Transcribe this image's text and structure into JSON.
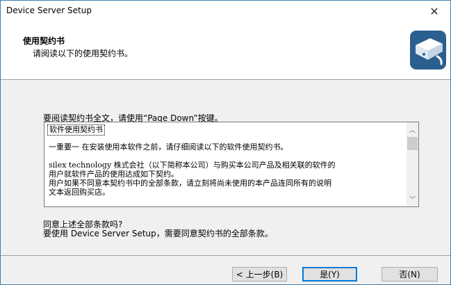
{
  "window": {
    "title": "Device Server Setup"
  },
  "header": {
    "title": "使用契约书",
    "subtitle": "请阅读以下的使用契约书。",
    "icon": "device-server-icon"
  },
  "instruction": "要阅读契约书全文，请使用“Page Down”按键。",
  "license": {
    "doc_title": "软件使用契约书",
    "paragraphs": [
      "一重要一 在安装使用本软件之前，请仔细阅读以下的软件使用契约书。",
      "silex technology 株式会社（以下简称本公司）与购买本公司产品及相关联的软件的",
      "用户就软件产品的使用达成如下契约。",
      "用户如果不同意本契约书中的全部条款，请立刻将尚未使用的本产品连同所有的说明",
      "文本返回购买店。"
    ]
  },
  "question": {
    "line1": "同意上述全部条款吗?",
    "line2": "要使用 Device Server Setup，需要同意契约书的全部条款。"
  },
  "buttons": {
    "back": "< 上一步(B)",
    "yes": "是(Y)",
    "no": "否(N)"
  },
  "colors": {
    "accent": "#0078d7",
    "icon_blue": "#2a5f8f"
  }
}
